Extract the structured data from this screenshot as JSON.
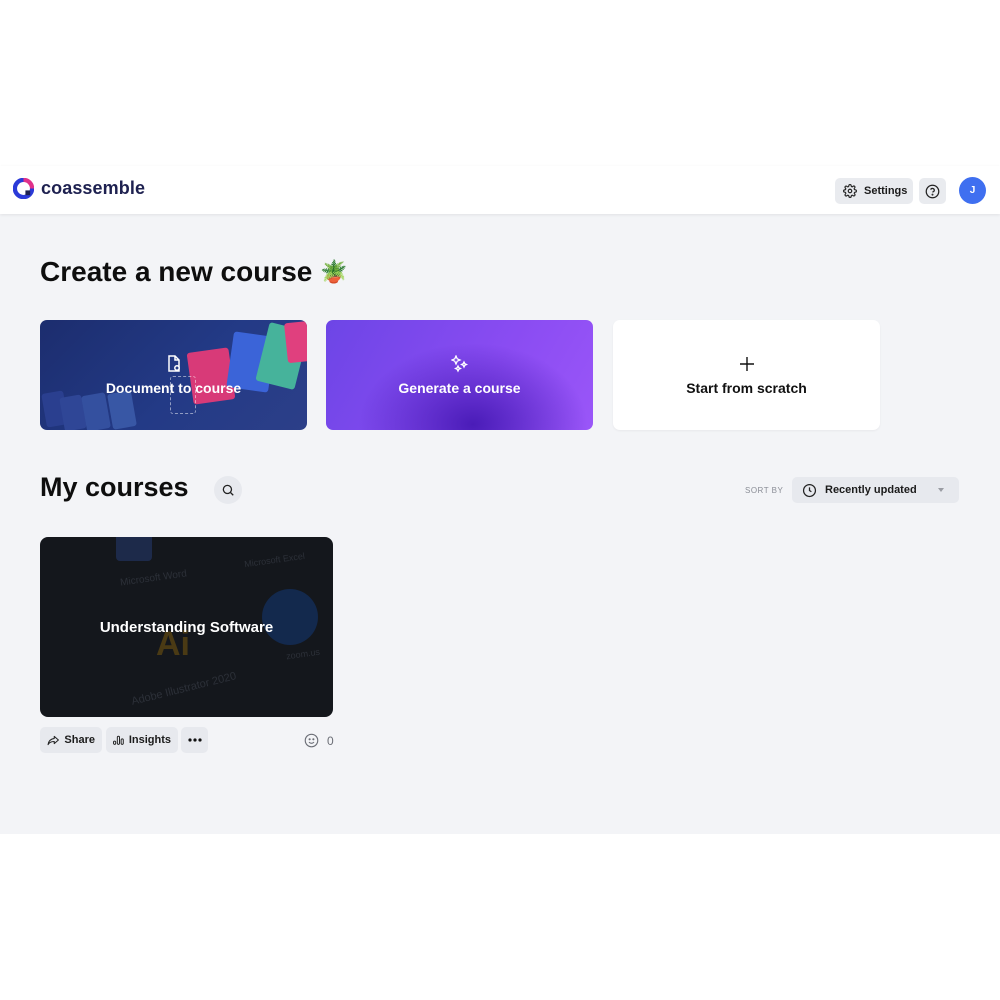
{
  "brand": {
    "name": "coassemble"
  },
  "header": {
    "settings_label": "Settings",
    "help_icon": "question-circle-icon",
    "avatar_initial": "J",
    "avatar_color": "#3f6ff0"
  },
  "create": {
    "title": "Create a new course",
    "title_emoji": "🪴",
    "cards": [
      {
        "label": "Document to course",
        "icon": "document-icon"
      },
      {
        "label": "Generate a course",
        "icon": "sparkles-icon"
      },
      {
        "label": "Start from scratch",
        "icon": "plus-icon"
      }
    ]
  },
  "courses": {
    "title": "My courses",
    "sort_label": "SORT BY",
    "sort_value": "Recently updated",
    "items": [
      {
        "title": "Understanding Software",
        "reactions_count": "0",
        "background_texts": [
          "Microsoft Word",
          "Microsoft Excel",
          "Adobe Illustrator 2020",
          "zoom.us",
          "Ai"
        ]
      }
    ],
    "actions": {
      "share": "Share",
      "insights": "Insights"
    }
  },
  "colors": {
    "brand_navy": "#1e2150",
    "generate_purple": "#8a4cf2",
    "document_blue": "#233a86"
  }
}
